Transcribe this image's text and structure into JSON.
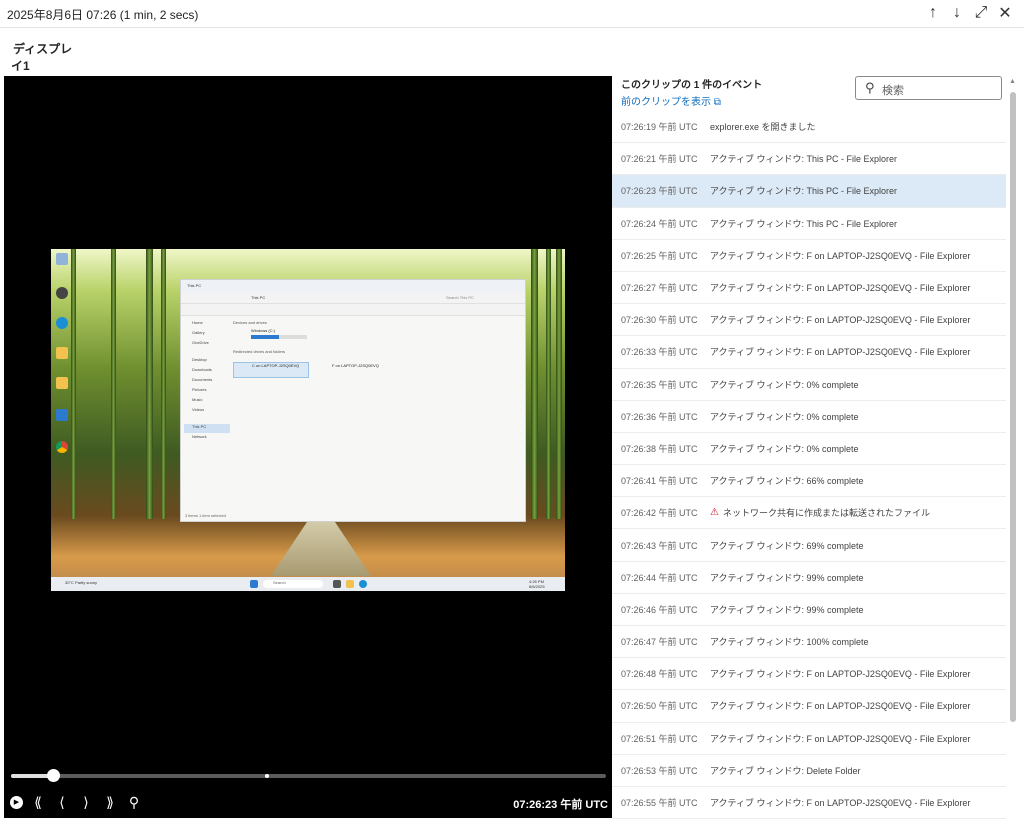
{
  "header": {
    "title": "2025年8月6日 07:26 (1 min, 2 secs)",
    "icons": [
      "arrow-up-icon",
      "arrow-down-icon",
      "expand-icon",
      "close-icon"
    ]
  },
  "tabs": [
    {
      "label": "ディスプレイ1",
      "active": true
    }
  ],
  "player": {
    "current_time": "07:26:23 午前 UTC",
    "progress": 0.07,
    "marker_position": 0.43,
    "screen": {
      "explorer_title": "This PC",
      "address": "This PC",
      "search_placeholder": "Search This PC",
      "sidebar_items": [
        "Home",
        "Gallery",
        "OneDrive",
        "Desktop",
        "Downloads",
        "Documents",
        "Pictures",
        "Music",
        "Videos",
        "This PC",
        "Network"
      ],
      "devices_heading": "Devices and drives",
      "drive_name": "Windows (C:)",
      "redirected_heading": "Redirected drives and folders",
      "drive_c": "C on LAPTOP-J2SQ0EVQ",
      "drive_f": "F on LAPTOP-J2SQ0EVQ",
      "status_text": "3 items   1 item selected",
      "taskbar_search": "Search",
      "weather": "30°C Partly sunny",
      "clock": "4:26 PM 8/6/2025"
    }
  },
  "panel": {
    "heading": "このクリップの 1 件のイベント",
    "prev_clip_link": "前のクリップを表示",
    "search_placeholder": "検索",
    "events": [
      {
        "time": "07:26:19 午前 UTC",
        "desc": "explorer.exe を開きました",
        "warn": false,
        "selected": false
      },
      {
        "time": "07:26:21 午前 UTC",
        "desc": "アクティブ ウィンドウ: This PC - File Explorer",
        "warn": false,
        "selected": false
      },
      {
        "time": "07:26:23 午前 UTC",
        "desc": "アクティブ ウィンドウ: This PC - File Explorer",
        "warn": false,
        "selected": true
      },
      {
        "time": "07:26:24 午前 UTC",
        "desc": "アクティブ ウィンドウ: This PC - File Explorer",
        "warn": false,
        "selected": false
      },
      {
        "time": "07:26:25 午前 UTC",
        "desc": "アクティブ ウィンドウ: F on LAPTOP-J2SQ0EVQ - File Explorer",
        "warn": false,
        "selected": false
      },
      {
        "time": "07:26:27 午前 UTC",
        "desc": "アクティブ ウィンドウ: F on LAPTOP-J2SQ0EVQ - File Explorer",
        "warn": false,
        "selected": false
      },
      {
        "time": "07:26:30 午前 UTC",
        "desc": "アクティブ ウィンドウ: F on LAPTOP-J2SQ0EVQ - File Explorer",
        "warn": false,
        "selected": false
      },
      {
        "time": "07:26:33 午前 UTC",
        "desc": "アクティブ ウィンドウ: F on LAPTOP-J2SQ0EVQ - File Explorer",
        "warn": false,
        "selected": false
      },
      {
        "time": "07:26:35 午前 UTC",
        "desc": "アクティブ ウィンドウ: 0% complete",
        "warn": false,
        "selected": false
      },
      {
        "time": "07:26:36 午前 UTC",
        "desc": "アクティブ ウィンドウ: 0% complete",
        "warn": false,
        "selected": false
      },
      {
        "time": "07:26:38 午前 UTC",
        "desc": "アクティブ ウィンドウ: 0% complete",
        "warn": false,
        "selected": false
      },
      {
        "time": "07:26:41 午前 UTC",
        "desc": "アクティブ ウィンドウ: 66% complete",
        "warn": false,
        "selected": false
      },
      {
        "time": "07:26:42 午前 UTC",
        "desc": "ネットワーク共有に作成または転送されたファイル",
        "warn": true,
        "selected": false
      },
      {
        "time": "07:26:43 午前 UTC",
        "desc": "アクティブ ウィンドウ: 69% complete",
        "warn": false,
        "selected": false
      },
      {
        "time": "07:26:44 午前 UTC",
        "desc": "アクティブ ウィンドウ: 99% complete",
        "warn": false,
        "selected": false
      },
      {
        "time": "07:26:46 午前 UTC",
        "desc": "アクティブ ウィンドウ: 99% complete",
        "warn": false,
        "selected": false
      },
      {
        "time": "07:26:47 午前 UTC",
        "desc": "アクティブ ウィンドウ: 100% complete",
        "warn": false,
        "selected": false
      },
      {
        "time": "07:26:48 午前 UTC",
        "desc": "アクティブ ウィンドウ: F on LAPTOP-J2SQ0EVQ - File Explorer",
        "warn": false,
        "selected": false
      },
      {
        "time": "07:26:50 午前 UTC",
        "desc": "アクティブ ウィンドウ: F on LAPTOP-J2SQ0EVQ - File Explorer",
        "warn": false,
        "selected": false
      },
      {
        "time": "07:26:51 午前 UTC",
        "desc": "アクティブ ウィンドウ: F on LAPTOP-J2SQ0EVQ - File Explorer",
        "warn": false,
        "selected": false
      },
      {
        "time": "07:26:53 午前 UTC",
        "desc": "アクティブ ウィンドウ: Delete Folder",
        "warn": false,
        "selected": false
      },
      {
        "time": "07:26:55 午前 UTC",
        "desc": "アクティブ ウィンドウ: F on LAPTOP-J2SQ0EVQ - File Explorer",
        "warn": false,
        "selected": false
      }
    ]
  },
  "colors": {
    "accent": "#0f6cbd",
    "selected_row": "#dce9f7",
    "warning": "#c50f1f",
    "player_bg": "#000000"
  }
}
